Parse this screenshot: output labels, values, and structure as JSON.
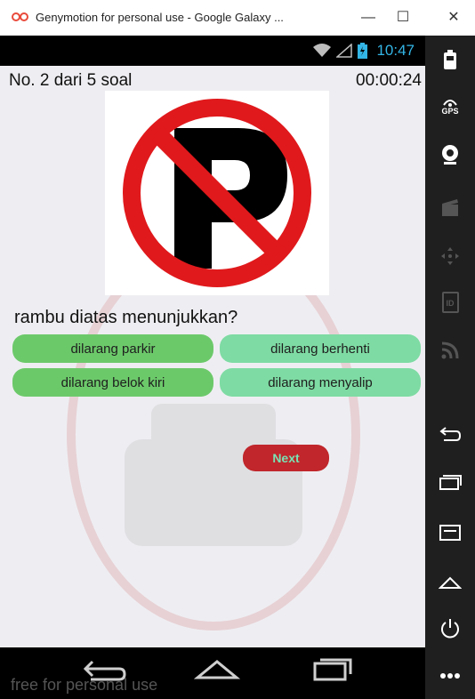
{
  "window": {
    "title": "Genymotion for personal use - Google Galaxy ...",
    "minimize": "—",
    "maximize": "☐",
    "close": "✕"
  },
  "statusbar": {
    "clock": "10:47"
  },
  "quiz": {
    "counter": "No. 2 dari 5 soal",
    "timer": "00:00:24",
    "question": "rambu diatas menunjukkan?",
    "answers": [
      "dilarang parkir",
      "dilarang berhenti",
      "dilarang belok kiri",
      "dilarang menyalip"
    ],
    "next_label": "Next"
  },
  "navbar": {
    "watermark": "free for personal use"
  },
  "sidepanel": {
    "gps_label": "GPS",
    "id_label": "ID",
    "tools": [
      "battery-icon",
      "gps-icon",
      "webcam-icon",
      "video-capture-icon",
      "dpad-icon",
      "id-icon",
      "rss-icon",
      "back-icon",
      "recent-apps-icon",
      "menu-icon",
      "home-icon",
      "power-icon",
      "more-icon"
    ]
  },
  "colors": {
    "answer_green": "#6cc96a",
    "answer_teal": "#7edba3",
    "next_bg": "#c0262b",
    "next_text": "#79e2b4",
    "clock": "#33b5e5"
  }
}
